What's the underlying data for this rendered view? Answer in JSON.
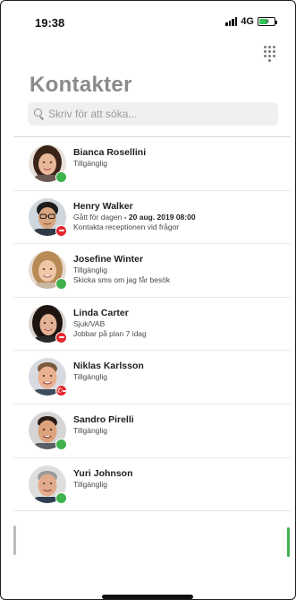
{
  "status_bar": {
    "time": "19:38",
    "network": "4G",
    "signal_icon": "signal-bars-icon",
    "battery_icon": "battery-charging-icon",
    "battery_color": "#34c759"
  },
  "header": {
    "dialpad_icon": "dialpad-icon",
    "title": "Kontakter"
  },
  "search": {
    "placeholder": "Skriv för att söka...",
    "value": ""
  },
  "colors": {
    "available": "#3fb24e",
    "busy": "#e2262c",
    "title": "#8a8a8a"
  },
  "contacts": [
    {
      "name": "Bianca Rosellini",
      "status": "Tillgänglig",
      "presence": "available"
    },
    {
      "name": "Henry Walker",
      "status": "Gått för dagen",
      "status_time": " - 20 aug. 2019 08:00",
      "note": "Kontakta receptionen vid frågor",
      "presence": "busy"
    },
    {
      "name": "Josefine Winter",
      "status": "Tillgänglig",
      "note": "Skicka sms om jag får besök",
      "presence": "available"
    },
    {
      "name": "Linda Carter",
      "status": "Sjuk/VAB",
      "note": "Jobbar på plan 7 idag",
      "presence": "busy"
    },
    {
      "name": "Niklas Karlsson",
      "status": "Tillgänglig",
      "presence": "on-call"
    },
    {
      "name": "Sandro Pirelli",
      "status": "Tillgänglig",
      "presence": "available"
    },
    {
      "name": "Yuri Johnson",
      "status": "Tillgänglig",
      "presence": "available"
    }
  ]
}
